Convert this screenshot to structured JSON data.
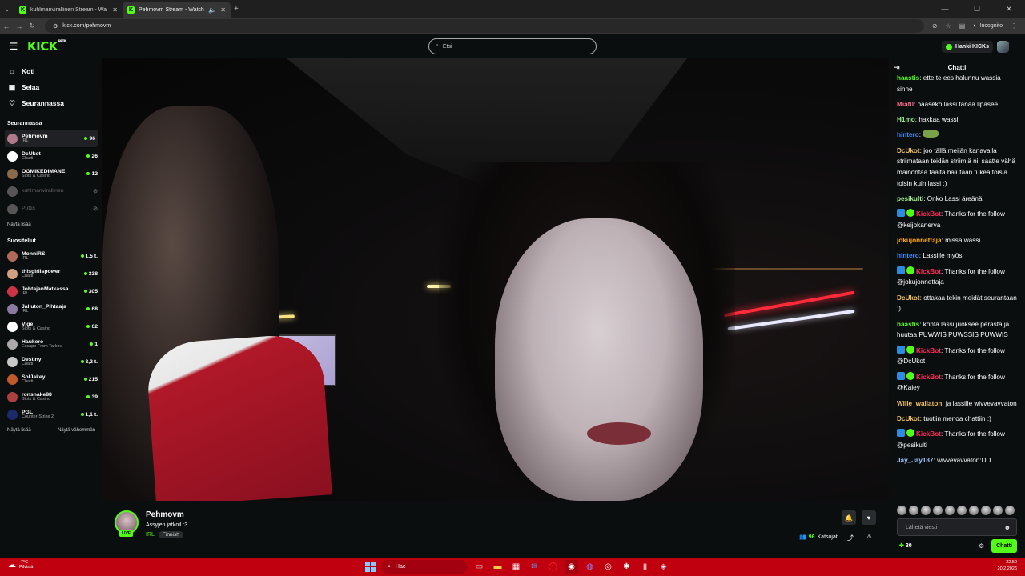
{
  "browser": {
    "tabs": [
      {
        "title": "kuhlmanvirallinen Stream - Wa",
        "active": false
      },
      {
        "title": "Pehmovm Stream - Watch",
        "active": true
      }
    ],
    "url": "kick.com/pehmovm",
    "incognito_label": "Incognito"
  },
  "header": {
    "logo": "KICK",
    "logo_beta": "BETA",
    "search_placeholder": "Etsi",
    "get_kicks": "Hanki KICKs"
  },
  "sidebar": {
    "nav": [
      {
        "label": "Koti",
        "icon": "home-icon"
      },
      {
        "label": "Selaa",
        "icon": "browse-icon"
      },
      {
        "label": "Seurannassa",
        "icon": "heart-icon"
      }
    ],
    "following_heading": "Seurannassa",
    "following": [
      {
        "name": "Pehmovm",
        "category": "IRL",
        "viewers": "96",
        "color": "#b07a8a",
        "selected": true
      },
      {
        "name": "DcUkot",
        "category": "Chatti",
        "viewers": "26",
        "color": "#ffffff"
      },
      {
        "name": "OGMIKEDIMANE",
        "category": "Slots & Casino",
        "viewers": "12",
        "color": "#8a6a4a"
      },
      {
        "name": "kuhlmanvirallinen",
        "category": "",
        "viewers": "",
        "color": "#555555",
        "offline": true
      },
      {
        "name": "Puttis",
        "category": "",
        "viewers": "",
        "color": "#555555",
        "offline": true
      }
    ],
    "following_more": "Näytä lisää",
    "recommended_heading": "Suositellut",
    "recommended": [
      {
        "name": "MonniRS",
        "category": "IRL",
        "viewers": "1,5 t.",
        "color": "#b06a5a"
      },
      {
        "name": "thisgirlispower",
        "category": "Chatti",
        "viewers": "338",
        "color": "#d0a080"
      },
      {
        "name": "JohtajanMatkassa",
        "category": "IRL",
        "viewers": "305",
        "color": "#cc3344"
      },
      {
        "name": "Jalluton_Pihtaaja",
        "category": "IRL",
        "viewers": "68",
        "color": "#8a7aa0"
      },
      {
        "name": "Vige",
        "category": "Slots & Casino",
        "viewers": "62",
        "color": "#ffffff"
      },
      {
        "name": "Haukero",
        "category": "Escape From Tarkov",
        "viewers": "1",
        "color": "#aaaaaa"
      },
      {
        "name": "Destiny",
        "category": "Chatti",
        "viewers": "3,2 t.",
        "color": "#c8c8c8"
      },
      {
        "name": "SolJakey",
        "category": "Chatti",
        "viewers": "215",
        "color": "#c05a2a"
      },
      {
        "name": "ronsnake88",
        "category": "Slots & Casino",
        "viewers": "39",
        "color": "#aa4040"
      },
      {
        "name": "PGL",
        "category": "Counter-Strike 2",
        "viewers": "1,1 t.",
        "color": "#1a2a6a"
      }
    ],
    "recommended_more": "Näytä lisää",
    "recommended_less": "Näytä vähemmän"
  },
  "stream": {
    "name": "Pehmovm",
    "title": "Assyjen jatkoil :3",
    "category": "IRL",
    "language_tag": "Finnish",
    "live_badge": "LIVE",
    "viewers": "96",
    "viewers_label": "Katsojat"
  },
  "chat": {
    "title": "Chatti",
    "messages": [
      {
        "user": "haastis",
        "color": "#53fc18",
        "text": "ette te ees halunnu wassia sinne"
      },
      {
        "user": "Miat0",
        "color": "#ff6b8a",
        "text": "pääsekö lassi tänää lipasee"
      },
      {
        "user": "H1mo",
        "color": "#a0f090",
        "text": "hakkaa wassi"
      },
      {
        "user": "hintero",
        "color": "#3a8fff",
        "text": "",
        "emote": true
      },
      {
        "user": "DcUkot",
        "color": "#f0c060",
        "text": "joo tällä meijän kanavalla striimataan teidän striimiä nii saatte vähä mainontaa täältä halutaan tukea toisia toisin kuin lassi :)"
      },
      {
        "user": "pesikulti",
        "color": "#a0f090",
        "text": "Onko Lassi äreänä"
      },
      {
        "user": "KickBot",
        "color": "#ff2a5a",
        "text": "Thanks for the follow @keijokanerva",
        "bot": true
      },
      {
        "user": "jokujonnettaja",
        "color": "#ffaa00",
        "text": "missä wassi"
      },
      {
        "user": "hintero",
        "color": "#3a8fff",
        "text": "Lassille myös"
      },
      {
        "user": "KickBot",
        "color": "#ff2a5a",
        "text": "Thanks for the follow @jokujonnettaja",
        "bot": true
      },
      {
        "user": "DcUkot",
        "color": "#f0c060",
        "text": "ottakaa tekin meidät seurantaan :)"
      },
      {
        "user": "haastis",
        "color": "#53fc18",
        "text": "kohta lassi juoksee perästä ja huutaa PUWWIS PUWSSIS PUWWIS"
      },
      {
        "user": "KickBot",
        "color": "#ff2a5a",
        "text": "Thanks for the follow @DcUkot",
        "bot": true
      },
      {
        "user": "KickBot",
        "color": "#ff2a5a",
        "text": "Thanks for the follow @Kaiey",
        "bot": true
      },
      {
        "user": "Wille_wallaton",
        "color": "#f0c060",
        "text": "ja lassille wivvevavvaton"
      },
      {
        "user": "DcUkot",
        "color": "#f0c060",
        "text": "tuotiin menoa chattiin :)"
      },
      {
        "user": "KickBot",
        "color": "#ff2a5a",
        "text": "Thanks for the follow @pesikulti",
        "bot": true
      },
      {
        "user": "Jay_Jay187",
        "color": "#a0c8ff",
        "text": "wivvevavvaton:DD"
      }
    ],
    "input_placeholder": "Lähetä viesti",
    "points": "30",
    "send_button": "Chatti"
  },
  "taskbar": {
    "temperature": "-7°C",
    "weather": "Pilvistä",
    "search": "Hae",
    "time": "22.50",
    "date": "20.2.2026"
  }
}
